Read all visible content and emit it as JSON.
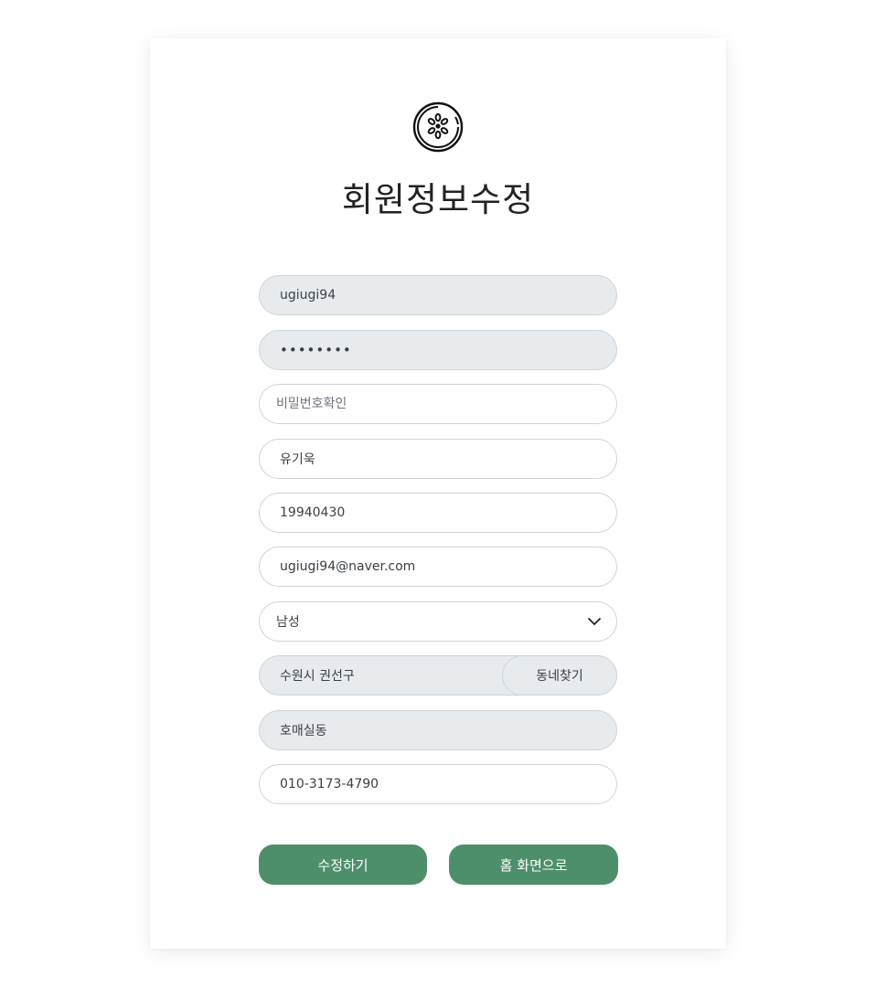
{
  "title": "회원정보수정",
  "logo_icon": "leaf-circle-icon",
  "fields": {
    "user_id": "ugiugi94",
    "password": "••••••••",
    "password_confirm_placeholder": "비밀번호확인",
    "name": "유기욱",
    "birth": "19940430",
    "email": "ugiugi94@naver.com",
    "gender": "남성",
    "address": "수원시 권선구",
    "find_dong_label": "동네찾기",
    "dong": "호매실동",
    "phone": "010-3173-4790"
  },
  "buttons": {
    "submit_label": "수정하기",
    "home_label": "홈 화면으로"
  },
  "colors": {
    "accent": "#4e8f6b",
    "disabled_bg": "#e8ebee",
    "border": "#cfd4da"
  }
}
